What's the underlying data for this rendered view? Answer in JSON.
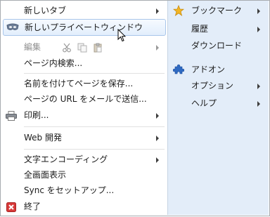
{
  "menu": {
    "left": [
      {
        "label": "新しいタブ",
        "arrow": true
      },
      {
        "label": "新しいプライベートウィンドウ",
        "arrow": false
      },
      {
        "label": "編集",
        "arrow": true,
        "disabled": true
      },
      {
        "label": "ページ内検索...",
        "arrow": false
      },
      {
        "label": "名前を付けてページを保存...",
        "arrow": false
      },
      {
        "label": "ページの URL をメールで送信...",
        "arrow": false
      },
      {
        "label": "印刷...",
        "arrow": true
      },
      {
        "label": "Web 開発",
        "arrow": true
      },
      {
        "label": "文字エンコーディング",
        "arrow": true
      },
      {
        "label": "全画面表示",
        "arrow": false
      },
      {
        "label": "Sync をセットアップ...",
        "arrow": false
      },
      {
        "label": "終了",
        "arrow": false
      }
    ],
    "right": [
      {
        "label": "ブックマーク",
        "arrow": true
      },
      {
        "label": "履歴",
        "arrow": true
      },
      {
        "label": "ダウンロード",
        "arrow": false
      },
      {
        "label": "アドオン",
        "arrow": false
      },
      {
        "label": "オプション",
        "arrow": true
      },
      {
        "label": "ヘルプ",
        "arrow": true
      }
    ]
  },
  "icons": {
    "private": "private-browsing-mask-icon",
    "cut": "cut-icon",
    "copy": "copy-icon",
    "paste": "paste-icon",
    "print": "printer-icon",
    "exit": "exit-icon",
    "bookmarks": "star-icon",
    "addons": "puzzle-piece-icon"
  },
  "colors": {
    "highlight_border": "#a9c6ea",
    "right_pane": "#e3edf9",
    "exit_red": "#d83a3a",
    "star_yellow": "#f2b525",
    "puzzle_blue": "#2f6ac2"
  }
}
